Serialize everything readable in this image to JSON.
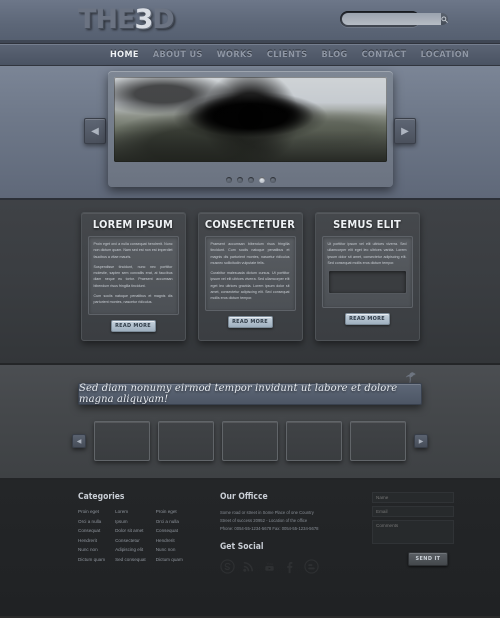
{
  "header": {
    "logo_main": "THE",
    "logo_accent": "3",
    "logo_tail": "D",
    "search_placeholder": "",
    "search_value": "",
    "search_icon": "search-icon"
  },
  "nav": {
    "items": [
      {
        "label": "HOME",
        "active": true
      },
      {
        "label": "ABOUT US",
        "active": false
      },
      {
        "label": "WORKS",
        "active": false
      },
      {
        "label": "CLIENTS",
        "active": false
      },
      {
        "label": "BLOG",
        "active": false
      },
      {
        "label": "CONTACT",
        "active": false
      },
      {
        "label": "LOCATION",
        "active": false
      }
    ]
  },
  "slider": {
    "prev_label": "◀",
    "next_label": "▶",
    "dot_count": 5,
    "active_dot": 4,
    "image_description": "Black and white photograph of a large dark flower in a rural landscape"
  },
  "columns": [
    {
      "title": "LOREM IPSUM",
      "paragraphs": [
        "Proin eget orci a nulla consequat hendrerit. Nunc non dictum quam. Nam sed est non est imperdiet faucibus a vitae mauris.",
        "Suspendisse tincidunt, nunc nec porttitor molestie, sapien sem convallis erat, at faucibus diam neque eu tortor. Praesent accumsan bibendum risus fringilla tincidunt.",
        "Cum sociis natoque penatibus et magnis dis parturient montes, nascetur ridiculus."
      ],
      "has_box": false,
      "button": "READ MORE"
    },
    {
      "title": "CONSECTETUER",
      "paragraphs": [
        "Praesent accumsan bibendum risus fringilla tincidunt. Cum sociis natoque penatibus et magnis dis parturient montes, nascetur ridiculus musnec sollicitudin vulputate felis.",
        "Curabitur malesuada dictum cursus. Ut porttitor ipsum vel elit ultrices viverra. Sed ullamcorper elit eget leo ultrices gravida. Lorem ipsum dolor sit amet, consectetur adipiscing elit. Sed consequat mollis eros dictum tempor."
      ],
      "has_box": false,
      "button": "READ MORE"
    },
    {
      "title": "SEMUS ELIT",
      "paragraphs": [
        "Ut porttitor ipsum vel elit ultrices viverra. Sed ullamcorper elit eget leo ultrices varida. Lorem ipsum dolor sit amet, consectetur adipiscing elit. Sed consequat mollis eros dictum tempor."
      ],
      "has_box": true,
      "button": "READ MORE"
    }
  ],
  "quote": {
    "text": "Sed diam nonumy eirmod tempor invidunt ut labore et dolore magna aliquyam!",
    "bird_icon": "bird-icon"
  },
  "gallery": {
    "prev_label": "◀",
    "next_label": "▶",
    "thumb_count": 5
  },
  "footer": {
    "categories": {
      "title": "Categories",
      "col1": [
        "Proin eget",
        "Orci a nulla",
        "Consequat",
        "Hendrerit",
        "Nunc non",
        "Dictum quam"
      ],
      "col2": [
        "Lorem",
        "Ipsum",
        "Dolor sit amet",
        "Consectetur",
        "Adipiscing elit",
        "Sed consequat"
      ],
      "col3": [
        "Proin eget",
        "Orci a nulla",
        "Consequat",
        "Hendrerit",
        "Nunc non",
        "Dictum quam"
      ]
    },
    "office": {
      "title": "Our Officce",
      "line1": "Some road or street in Some Place of one Country",
      "line2": "Street of success 20952 - Location of the office",
      "line3": "Phone: 0054-55-1234-5678    Fax: 0054-55-1234-5678"
    },
    "social": {
      "title": "Get Social",
      "items": [
        "skype-icon",
        "rss-icon",
        "youtube-icon",
        "facebook-icon",
        "blogger-icon"
      ]
    },
    "form": {
      "name_placeholder": "Name",
      "email_placeholder": "Email",
      "comments_placeholder": "Comments",
      "submit_label": "SEND IT"
    }
  }
}
